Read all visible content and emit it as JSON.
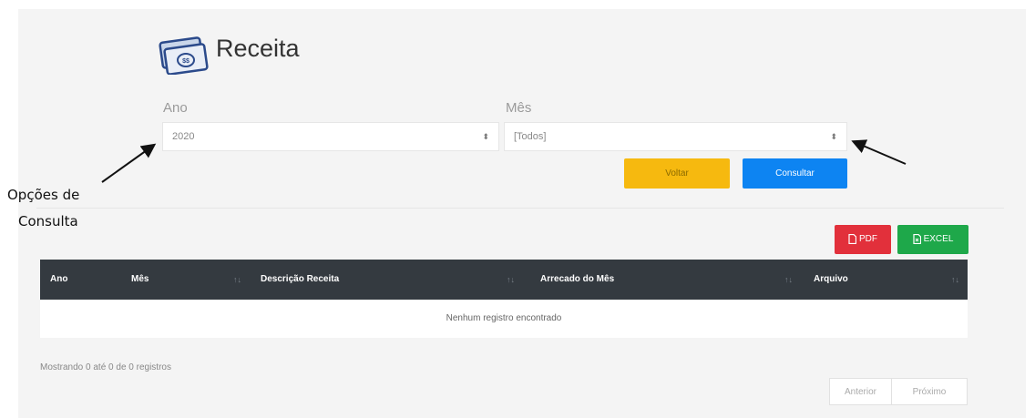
{
  "page": {
    "title": "Receita"
  },
  "filters": {
    "year_label": "Ano",
    "year_value": "2020",
    "month_label": "Mês",
    "month_value": "[Todos]"
  },
  "buttons": {
    "back": "Voltar",
    "query": "Consultar",
    "pdf": "PDF",
    "excel": "EXCEL"
  },
  "table": {
    "columns": [
      "Ano",
      "Mês",
      "Descrição Receita",
      "Arrecado do Mês",
      "Arquivo"
    ],
    "empty_message": "Nenhum registro encontrado"
  },
  "footer": {
    "info": "Mostrando 0 até 0 de 0 registros",
    "prev": "Anterior",
    "next": "Próximo"
  },
  "annotation": {
    "line1": "Opções de",
    "line2": "Consulta"
  },
  "colors": {
    "voltar": "#f6b90f",
    "consultar": "#0d84f2",
    "pdf": "#e2303b",
    "excel": "#1ea84a",
    "header": "#343a40"
  },
  "icons": [
    "money-icon",
    "caret-icon",
    "pdf-file-icon",
    "excel-file-icon",
    "sort-icon",
    "arrow-icon"
  ]
}
